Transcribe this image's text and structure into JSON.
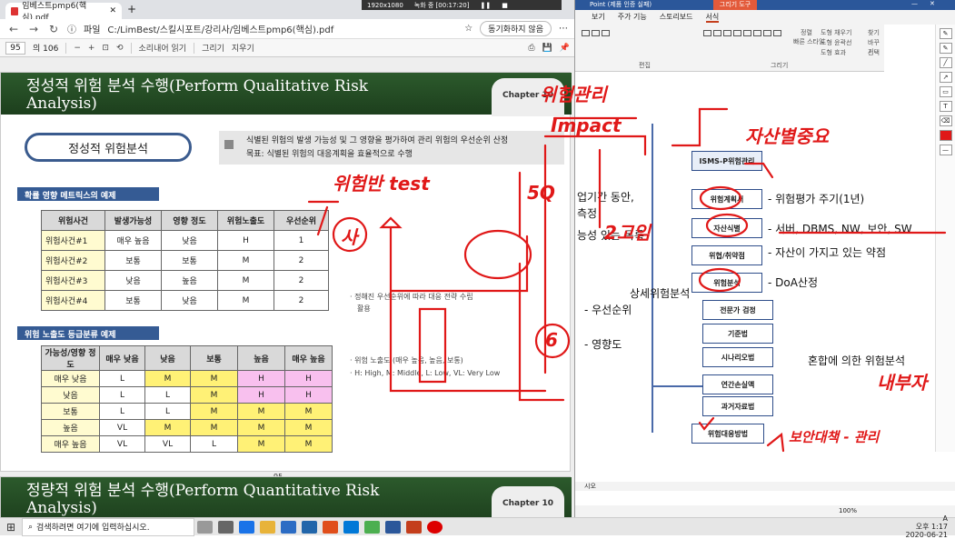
{
  "browser": {
    "tab_title": "임베스트pmp6(핵심).pdf",
    "address": "C:/LimBest/스킬시포트/강리사/임베스트pmp6(핵심).pdf",
    "address_prefix": "파일",
    "sync_label": "동기화하지 않음",
    "page_current": "95",
    "page_total": "의 106",
    "zoom_minus": "−",
    "zoom_plus": "+",
    "read_aloud": "소리내어 읽기",
    "draw": "그리기",
    "erase": "지우기"
  },
  "slide1": {
    "title": "정성적 위험 분석 수행(Perform Qualitative Risk Analysis)",
    "chapter": "Chapter 10",
    "pill": "정성적 위험분석",
    "desc_line1": "식별된 위험의 발생 가능성 및 그 영향을 평가하여 관리 위험의 우선순위 산정",
    "desc_line2": "목표: 식별된 위험의 대응계획을 효율적으로 수행",
    "section1": "확률 영향 메트릭스의 예제",
    "table1": {
      "headers": [
        "위험사건",
        "발생가능성",
        "영향 정도",
        "위험노출도",
        "우선순위"
      ],
      "rows": [
        [
          "위험사건#1",
          "매우 높음",
          "낮음",
          "H",
          "1"
        ],
        [
          "위험사건#2",
          "보통",
          "보통",
          "M",
          "2"
        ],
        [
          "위험사건#3",
          "낮음",
          "높음",
          "M",
          "2"
        ],
        [
          "위험사건#4",
          "보통",
          "낮음",
          "M",
          "2"
        ]
      ]
    },
    "note1a": "· 정해진 우선순위에 따라 대응 전략 수립",
    "note1b": "활용",
    "section2": "위험 노출도 등급분류 예제",
    "table2": {
      "headers": [
        "가능성/영향 정도",
        "매우 낮음",
        "낮음",
        "보통",
        "높음",
        "매우 높음"
      ],
      "rows": [
        [
          "매우 낮음",
          "L",
          "M",
          "M",
          "H",
          "H"
        ],
        [
          "낮음",
          "L",
          "L",
          "M",
          "H",
          "H"
        ],
        [
          "보통",
          "L",
          "L",
          "M",
          "M",
          "M"
        ],
        [
          "높음",
          "VL",
          "M",
          "M",
          "M",
          "M"
        ],
        [
          "매우 높음",
          "VL",
          "VL",
          "L",
          "M",
          "M"
        ]
      ],
      "colors": [
        [
          "",
          "Y",
          "Y",
          "P",
          "P"
        ],
        [
          "",
          "",
          "Y",
          "P",
          "P"
        ],
        [
          "",
          "",
          "Y",
          "Y",
          "Y"
        ],
        [
          "",
          "Y",
          "Y",
          "Y",
          "Y"
        ],
        [
          "",
          "",
          "",
          "Y",
          "Y"
        ]
      ]
    },
    "note2a": "· 위험 노출도 (매우 높음, 높음, 보통)",
    "note2b": "· H: High, M: Middle, L: Low, VL: Very Low",
    "page_number": "95"
  },
  "slide2": {
    "title": "정량적 위험 분석 수행(Perform Quantitative Risk Analysis)",
    "chapter": "Chapter 10"
  },
  "recorder": {
    "resolution": "1920x1080",
    "recording": "녹화 중 [00:17:20]"
  },
  "ppt": {
    "title_warning": "Point (제품 인증 실패)",
    "draw_tools": "그리기 도구",
    "tabs": [
      "보기",
      "주가 기능",
      "스토리보드",
      "서식"
    ],
    "ribbon_groups": [
      "편집",
      "그리기"
    ],
    "ribbon_items": [
      "도형 채우기",
      "도형 윤곽선",
      "도형 효과",
      "찾기",
      "바꾸기",
      "선택",
      "빠른 스타일",
      "정렬"
    ],
    "flow": {
      "top": "ISMS-P위험관리",
      "b1": "위험계획서",
      "b2": "자산식별",
      "b3": "위협/취약점",
      "b4": "위험분석",
      "b5": "전문가 검정",
      "b6": "기준법",
      "b7": "시나리오법",
      "b8": "연간손실액",
      "b9": "과거자료법",
      "b10": "위험대응방법"
    },
    "labels": {
      "l1": "- 위험평가 주기(1년)",
      "l2": "- 서버, DBMS, NW, 보안, SW",
      "l3": "- 자산이 가지고 있는 약점",
      "l4": "- DoA산정",
      "l5": "상세위험분석",
      "l6": "- 우선순위",
      "l7": "- 영향도",
      "l8": "혼합에 의한 위험분석",
      "side1": "업기간 동안,",
      "side2": "측정",
      "side3": "능성 있는 목록"
    },
    "notes_hint": "시오",
    "zoom": "100%"
  },
  "ink": {
    "t1": "위험관리",
    "t2": "Impact",
    "t3": "자산별중요",
    "t4": "위험반 test",
    "t5": "사",
    "t6": "5Q",
    "t7": "2고임",
    "t8": "6",
    "t9": "내부자",
    "t10": "보안대책 - 관리"
  },
  "taskbar": {
    "search_placeholder": "검색하려면 여기에 입력하십시오.",
    "time": "오후 1:17",
    "date": "2020-06-21",
    "lang": "A"
  }
}
